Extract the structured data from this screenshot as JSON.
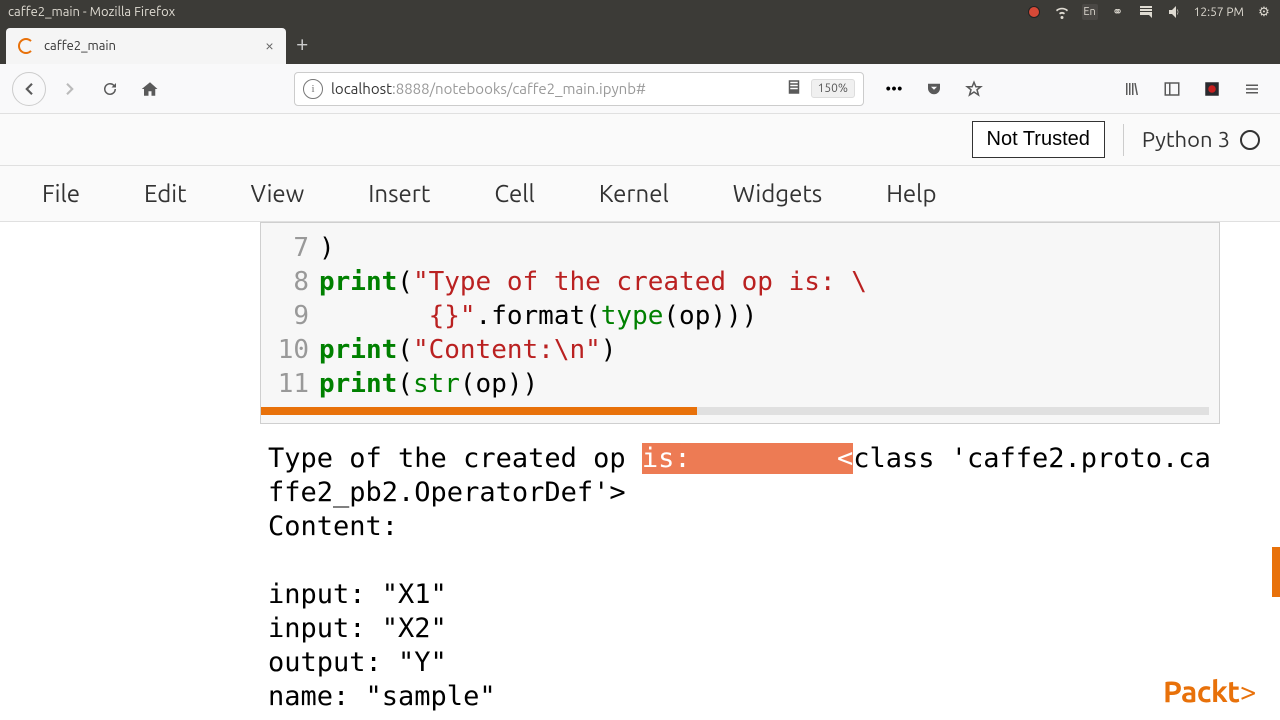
{
  "window": {
    "title": "caffe2_main - Mozilla Firefox"
  },
  "panel": {
    "lang": "En",
    "time": "12:57 PM"
  },
  "tab": {
    "title": "caffe2_main"
  },
  "url": {
    "host": "localhost",
    "path": ":8888/notebooks/caffe2_main.ipynb#",
    "zoom": "150%"
  },
  "header": {
    "trust": "Not Trusted",
    "kernel": "Python 3"
  },
  "menu": {
    "file": "File",
    "edit": "Edit",
    "view": "View",
    "insert": "Insert",
    "cell": "Cell",
    "kernel": "Kernel",
    "widgets": "Widgets",
    "help": "Help"
  },
  "code": {
    "l7": {
      "n": "7",
      "body": ")"
    },
    "l8": {
      "n": "8",
      "kw": "print",
      "s1": "(",
      "str": "\"Type of the created op is: \\"
    },
    "l9": {
      "n": "9",
      "pad": "       ",
      "str": "{}\"",
      "s1": ".format(",
      "bi": "type",
      "s2": "(op)))"
    },
    "l10": {
      "n": "10",
      "kw": "print",
      "s1": "(",
      "str": "\"Content:\\n\"",
      "s2": ")"
    },
    "l11": {
      "n": "11",
      "kw": "print",
      "s1": "(",
      "bi": "str",
      "s2": "(op))"
    }
  },
  "output": {
    "pre": "Type of the created op ",
    "hl": "is:         <",
    "post": "class 'caffe2.proto.caffe2_pb2.OperatorDef'>",
    "content_label": "Content:",
    "body": "input: \"X1\"\ninput: \"X2\"\noutput: \"Y\"\nname: \"sample\""
  },
  "brand": {
    "name": "Packt",
    "suffix": ">"
  }
}
